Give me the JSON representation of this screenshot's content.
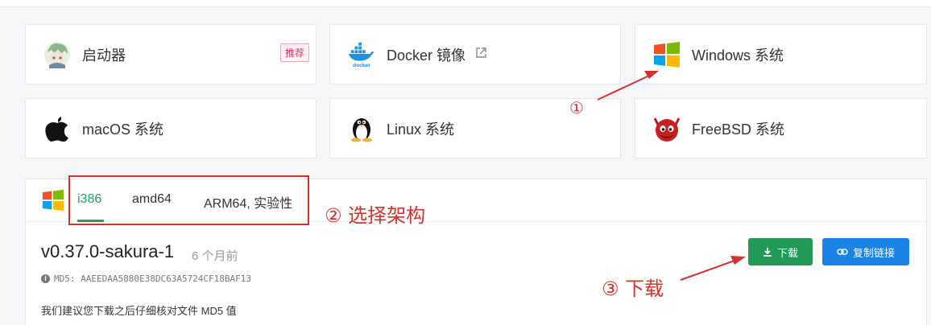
{
  "cards": [
    {
      "label": "启动器",
      "badge": "推荐",
      "icon": "launcher-avatar-icon"
    },
    {
      "label": "Docker 镜像",
      "icon": "docker-icon"
    },
    {
      "label": "Windows 系统",
      "icon": "windows-icon"
    },
    {
      "label": "macOS 系统",
      "icon": "apple-icon"
    },
    {
      "label": "Linux 系统",
      "icon": "linux-penguin-icon"
    },
    {
      "label": "FreeBSD 系统",
      "icon": "freebsd-icon"
    }
  ],
  "tabs": [
    "i386",
    "amd64",
    "ARM64, 实验性"
  ],
  "release": {
    "version": "v0.37.0-sakura-1",
    "ago": "6 个月前",
    "md5": "MD5: AAEEDAA5880E38DC63A5724CF18BAF13",
    "note": "我们建议您下载之后仔细核对文件 MD5 值"
  },
  "buttons": {
    "download": "下载",
    "copy_link": "复制链接"
  },
  "annotations": {
    "a1": "①",
    "a2": "② 选择架构",
    "a3": "③ 下载"
  },
  "colors": {
    "accent_green": "#229a56",
    "accent_blue": "#1b82e6",
    "annotation_red": "#d5302b"
  }
}
